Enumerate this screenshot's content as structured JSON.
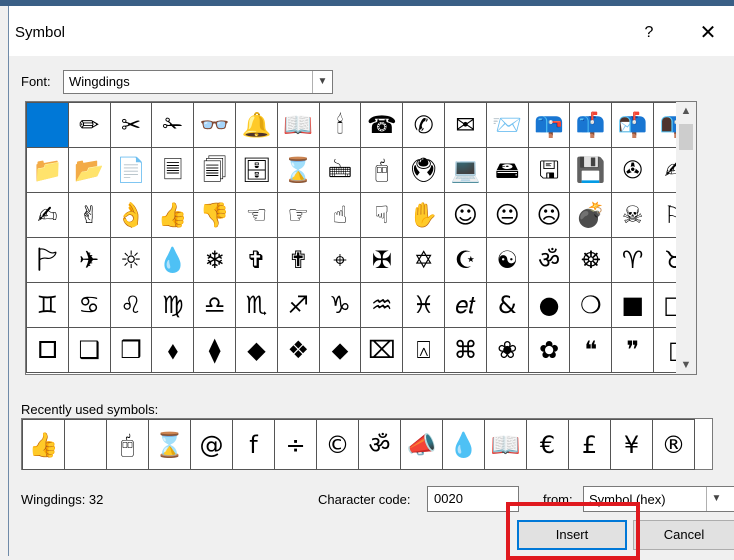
{
  "dialog": {
    "title": "Symbol",
    "help_label": "?",
    "close_label": "✕"
  },
  "font": {
    "label": "Font:",
    "value": "Wingdings"
  },
  "symbol_grid": [
    [
      "■",
      "✏",
      "✂",
      "✁",
      "👓",
      "🔔",
      "📖",
      "🕯",
      "☎",
      "✆",
      "✉",
      "📨",
      "📪",
      "📫",
      "📬",
      "📭"
    ],
    [
      "📁",
      "📂",
      "📄",
      "🗏",
      "🗐",
      "🗄",
      "⌛",
      "🖮",
      "🖰",
      "🖲",
      "💻",
      "🖴",
      "🖫",
      "💾",
      "✇",
      "✍"
    ],
    [
      "✍",
      "✌",
      "👌",
      "👍",
      "👎",
      "☜",
      "☞",
      "☝",
      "☟",
      "✋",
      "☺",
      "😐",
      "☹",
      "💣",
      "☠",
      "⚐"
    ],
    [
      "🏱",
      "✈",
      "☼",
      "💧",
      "❄",
      "✞",
      "✟",
      "⌖",
      "✠",
      "✡",
      "☪",
      "☯",
      "ॐ",
      "☸",
      "♈",
      "♉"
    ],
    [
      "♊",
      "♋",
      "♌",
      "♍",
      "♎",
      "♏",
      "♐",
      "♑",
      "♒",
      "♓",
      "𝑒𝑡",
      "&",
      "●",
      "❍",
      "■",
      "□"
    ],
    [
      "🞐",
      "❑",
      "❒",
      "⬧",
      "⧫",
      "◆",
      "❖",
      "⬥",
      "⌧",
      "⍓",
      "⌘",
      "❀",
      "✿",
      "❝",
      "❞",
      "▯"
    ]
  ],
  "recent": {
    "label": "Recently used symbols:",
    "symbols": [
      "👍",
      "",
      "🖰",
      "⌛",
      "@",
      "f",
      "÷",
      "©",
      "ॐ",
      "📣",
      "💧",
      "📖",
      "€",
      "£",
      "¥",
      "®"
    ]
  },
  "status": {
    "text": "Wingdings: 32"
  },
  "character_code": {
    "label": "Character code:",
    "value": "0020"
  },
  "from": {
    "label": "from:",
    "value": "Symbol (hex)"
  },
  "buttons": {
    "insert": "Insert",
    "cancel": "Cancel"
  },
  "colors": {
    "selection": "#0078d7",
    "highlight": "#e0191f"
  }
}
